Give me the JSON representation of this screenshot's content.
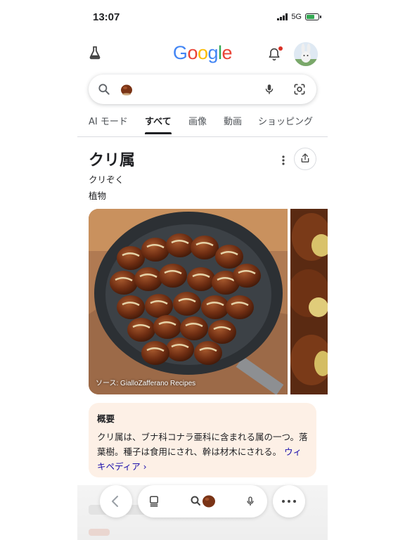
{
  "status_bar": {
    "time": "13:07",
    "network": "5G",
    "battery_level": 0.7
  },
  "header": {
    "logo": [
      {
        "ch": "G",
        "color": "#4285F4"
      },
      {
        "ch": "o",
        "color": "#EA4335"
      },
      {
        "ch": "o",
        "color": "#FBBC05"
      },
      {
        "ch": "g",
        "color": "#4285F4"
      },
      {
        "ch": "l",
        "color": "#34A853"
      },
      {
        "ch": "e",
        "color": "#EA4335"
      }
    ],
    "icons": [
      "labs-icon",
      "notification-bell-icon",
      "avatar"
    ]
  },
  "search": {
    "query_icon": "chestnut-image-chip",
    "icons": [
      "search-icon",
      "mic-icon",
      "lens-icon"
    ]
  },
  "tabs": [
    {
      "label": "AI モード",
      "active": false
    },
    {
      "label": "すべて",
      "active": true
    },
    {
      "label": "画像",
      "active": false
    },
    {
      "label": "動画",
      "active": false
    },
    {
      "label": "ショッピング",
      "active": false
    }
  ],
  "knowledge_panel": {
    "title": "クリ属",
    "reading": "クリぞく",
    "type": "植物",
    "image_source": "ソース: GialloZafferano Recipes"
  },
  "overview": {
    "heading": "概要",
    "text": "クリ属は、ブナ科コナラ亜科に含まれる属の一つ。落葉樹。種子は食用にされ、幹は材木にされる。",
    "link": "ウィキペディア ›"
  },
  "bottom_nav": {
    "icons": [
      "back-icon",
      "tabs-icon",
      "search-icon",
      "mic-icon",
      "more-icon"
    ]
  },
  "colors": {
    "accent": "#202124",
    "overview_bg": "#fdf0e6",
    "link": "#1a0dab"
  }
}
